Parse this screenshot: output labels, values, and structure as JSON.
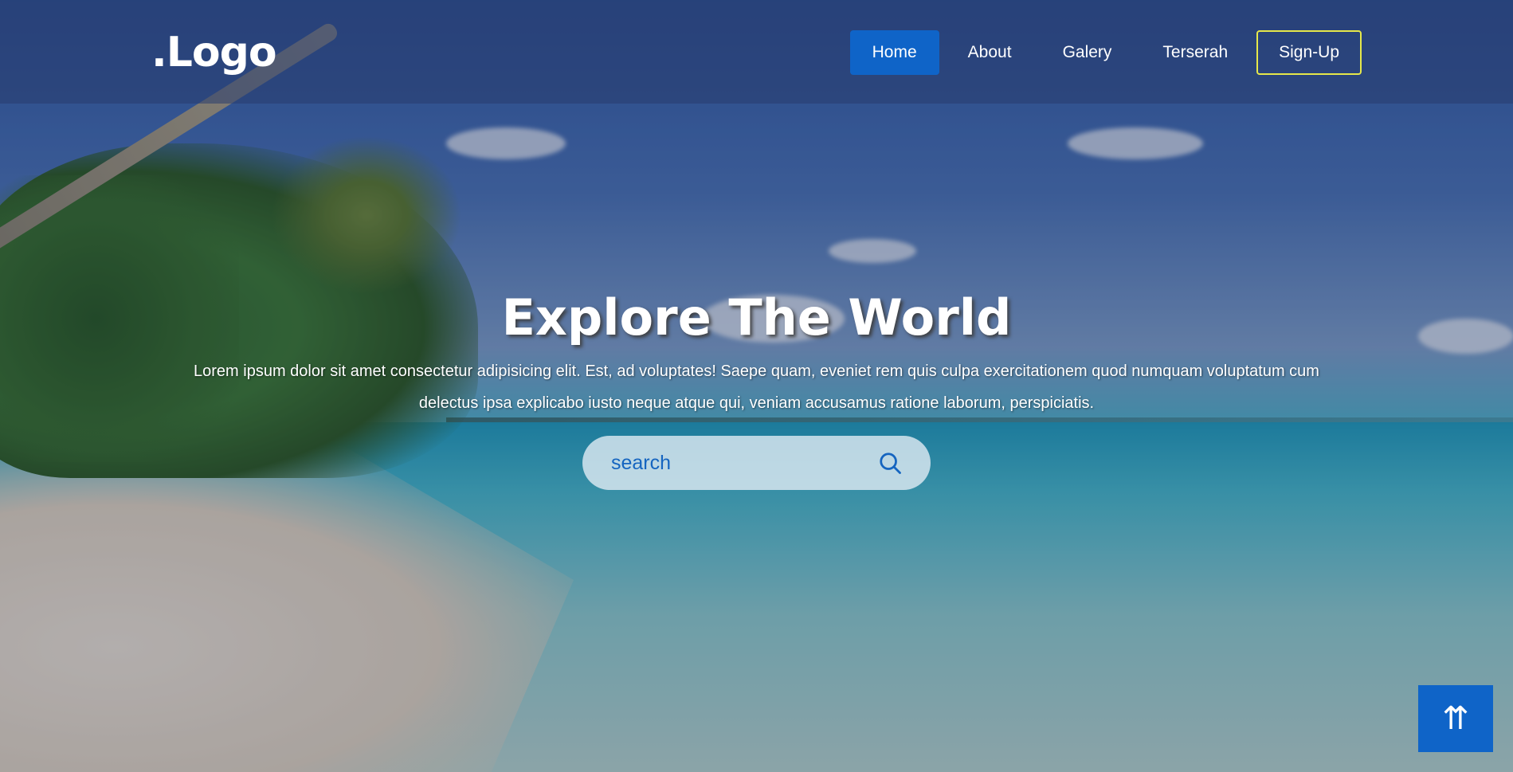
{
  "navbar": {
    "logo": ".Logo",
    "links": [
      {
        "label": "Home",
        "active": true
      },
      {
        "label": "About",
        "active": false
      },
      {
        "label": "Galery",
        "active": false
      },
      {
        "label": "Terserah",
        "active": false
      },
      {
        "label": "Sign-Up",
        "active": false
      }
    ]
  },
  "hero": {
    "title": "Explore The World",
    "description": "Lorem ipsum dolor sit amet consectetur adipisicing elit. Est, ad voluptates! Saepe quam, eveniet rem quis culpa exercitationem quod numquam voluptatum cum delectus ipsa explicabo iusto neque atque qui, veniam accusamus ratione laborum, perspiciatis."
  },
  "search": {
    "placeholder": "search",
    "icon": "search-icon"
  },
  "scroll_top": {
    "label": "⇈",
    "icon": "arrow-up-double-icon"
  },
  "colors": {
    "accent": "#0f64c8",
    "signup_border": "#e6e84a",
    "search_text": "#1565c0"
  }
}
